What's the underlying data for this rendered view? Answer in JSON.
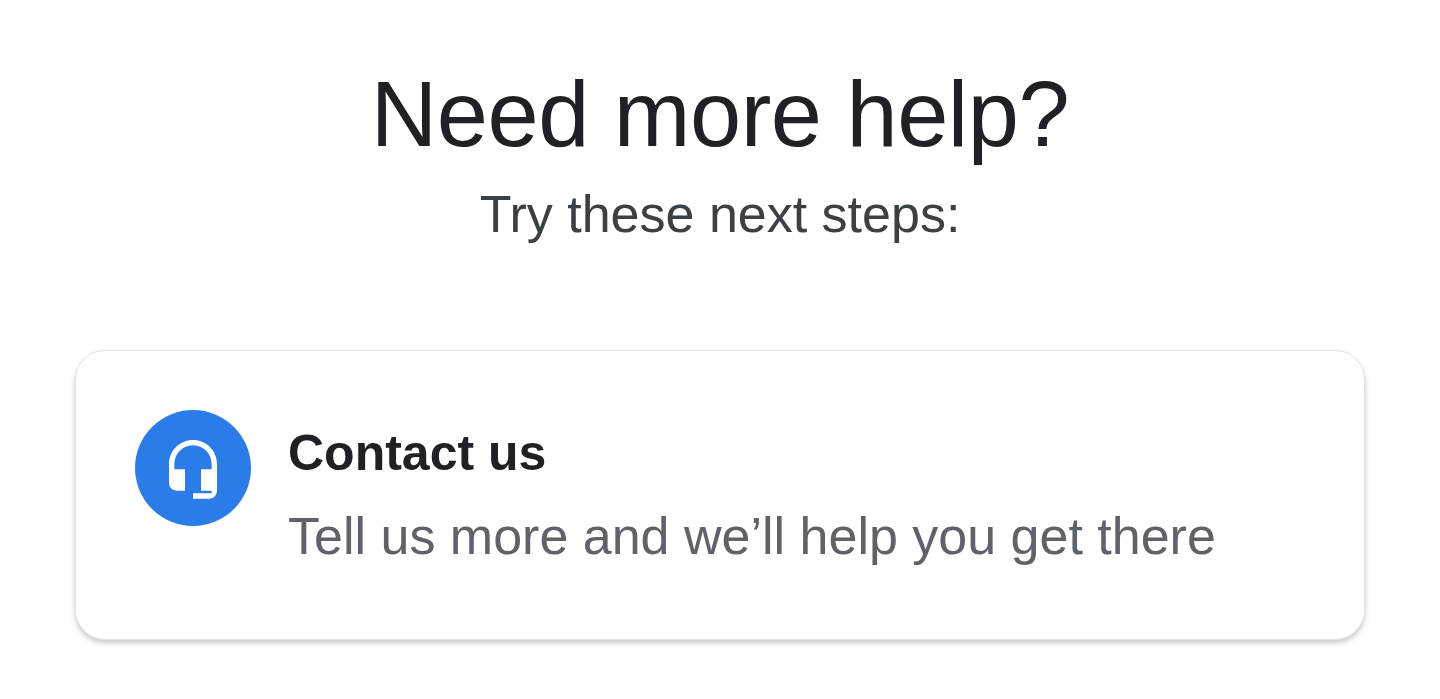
{
  "heading": {
    "title": "Need more help?",
    "subtitle": "Try these next steps:"
  },
  "next_steps": [
    {
      "kind": "contact",
      "title": "Contact us",
      "description": "Tell us more and we’ll help you get there"
    }
  ]
}
